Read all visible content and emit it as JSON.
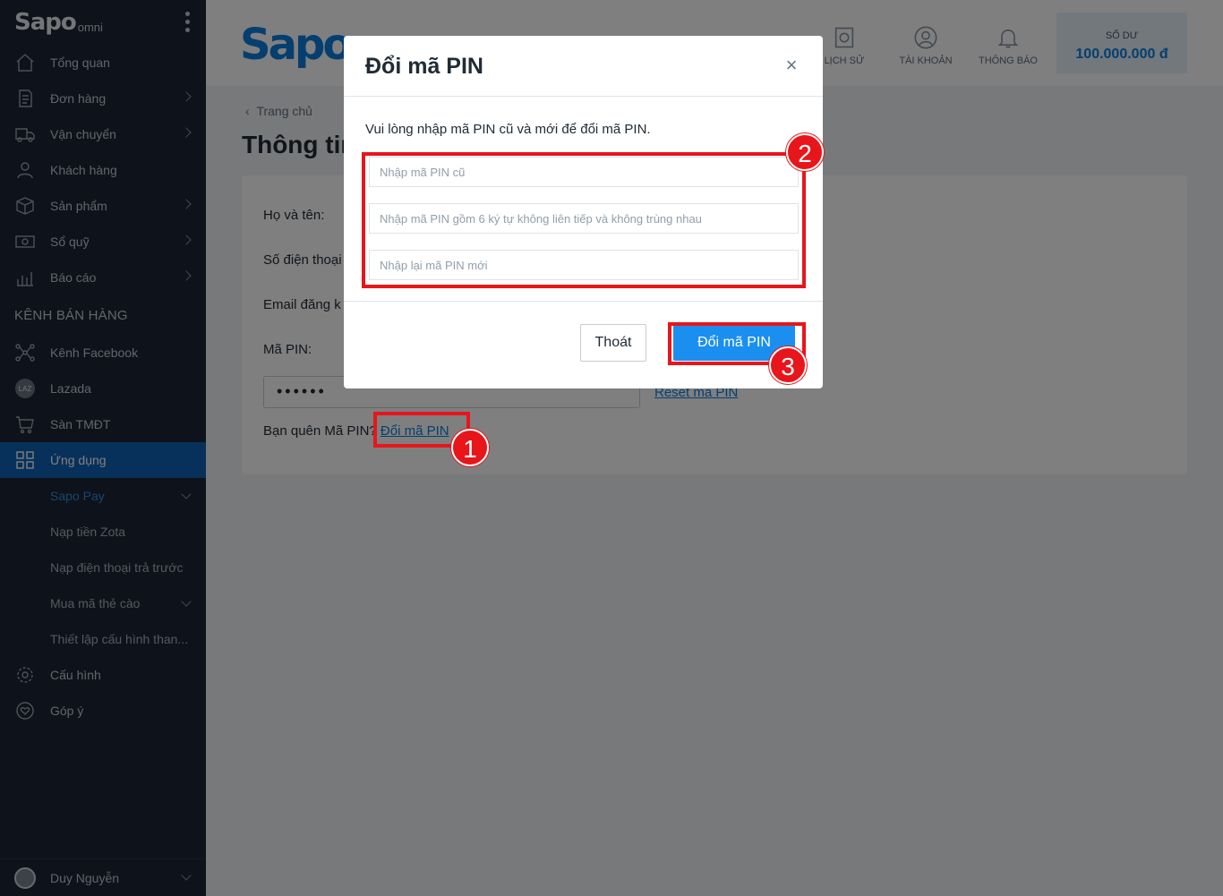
{
  "sidebar": {
    "brand": "Sapo",
    "brand_suffix": "omni",
    "items": [
      {
        "label": "Tổng quan",
        "icon": "home-icon"
      },
      {
        "label": "Đơn hàng",
        "icon": "order-icon"
      },
      {
        "label": "Vận chuyển",
        "icon": "truck-icon"
      },
      {
        "label": "Khách hàng",
        "icon": "user-icon"
      },
      {
        "label": "Sản phẩm",
        "icon": "box-icon"
      },
      {
        "label": "Sổ quỹ",
        "icon": "cash-icon"
      },
      {
        "label": "Báo cáo",
        "icon": "chart-icon"
      }
    ],
    "section_title": "KÊNH BÁN HÀNG",
    "channels": [
      {
        "label": "Kênh Facebook",
        "icon": "share-icon"
      },
      {
        "label": "Lazada",
        "icon": "lazada-icon",
        "badge": "LAZ"
      },
      {
        "label": "Sàn TMĐT",
        "icon": "cart-icon"
      },
      {
        "label": "Ứng dụng",
        "icon": "apps-icon"
      }
    ],
    "subitems": [
      {
        "label": "Sapo Pay"
      },
      {
        "label": "Nạp tiền Zota"
      },
      {
        "label": "Nạp điện thoại trả trước"
      },
      {
        "label": "Mua mã thẻ cào"
      },
      {
        "label": "Thiết lập cấu hình than..."
      }
    ],
    "bottom_items": [
      {
        "label": "Cấu hình",
        "icon": "gear-icon"
      },
      {
        "label": "Góp ý",
        "icon": "heart-icon"
      }
    ],
    "user_name": "Duy Nguyễn"
  },
  "header": {
    "logo": "Sapo",
    "nav": [
      {
        "label": "LỊCH SỬ",
        "icon": "history-icon"
      },
      {
        "label": "TÀI KHOẢN",
        "icon": "account-icon"
      },
      {
        "label": "THÔNG BÁO",
        "icon": "bell-icon"
      }
    ],
    "balance_label": "SỐ DƯ",
    "balance_value": "100.000.000 đ"
  },
  "content": {
    "breadcrumb": "Trang chủ",
    "title": "Thông tin",
    "fields": {
      "name_label": "Họ và tên:",
      "phone_label": "Số điện thoại",
      "email_label": "Email đăng k",
      "pin_label": "Mã PIN:",
      "pin_value": "••••••",
      "reset_link": "Reset mã PIN",
      "forgot_text": "Bạn quên Mã PIN?",
      "change_link": "Đổi mã PIN"
    }
  },
  "modal": {
    "title": "Đổi mã PIN",
    "close": "×",
    "description": "Vui lòng nhập mã PIN cũ và mới để đổi mã PIN.",
    "old_pin_placeholder": "Nhập mã PIN cũ",
    "new_pin_placeholder": "Nhập mã PIN gồm 6 ký tự không liên tiếp và không trùng nhau",
    "confirm_pin_placeholder": "Nhập lại mã PIN mới",
    "exit_label": "Thoát",
    "submit_label": "Đổi mã PIN"
  },
  "annotations": {
    "step1": "1",
    "step2": "2",
    "step3": "3",
    "color": "#e8151b"
  }
}
